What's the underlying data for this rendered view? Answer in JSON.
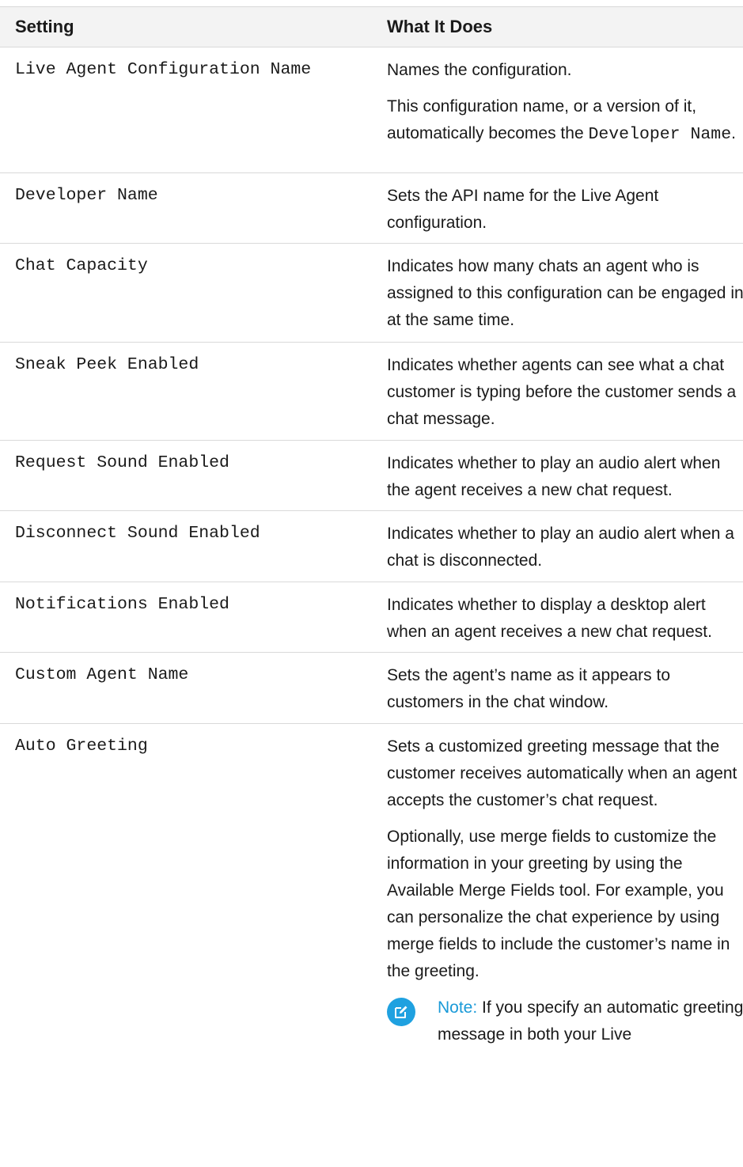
{
  "header": {
    "setting": "Setting",
    "what_it_does": "What It Does"
  },
  "rows": [
    {
      "setting": "Live Agent Configuration Name",
      "p1": "Names the configuration.",
      "p2_pre": "This configuration name, or a version of it, automatically becomes the ",
      "p2_code": "Developer Name",
      "p2_post": "."
    },
    {
      "setting": "Developer Name",
      "desc": "Sets the API name for the Live Agent configuration."
    },
    {
      "setting": "Chat Capacity",
      "desc": "Indicates how many chats an agent who is assigned to this configuration can be engaged in at the same time."
    },
    {
      "setting": "Sneak Peek Enabled",
      "desc": "Indicates whether agents can see what a chat customer is typing before the customer sends a chat message."
    },
    {
      "setting": "Request Sound Enabled",
      "desc": "Indicates whether to play an audio alert when the agent receives a new chat request."
    },
    {
      "setting": "Disconnect Sound Enabled",
      "desc": "Indicates whether to play an audio alert when a chat is disconnected."
    },
    {
      "setting": "Notifications Enabled",
      "desc": "Indicates whether to display a desktop alert when an agent receives a new chat request."
    },
    {
      "setting": "Custom Agent Name",
      "desc": "Sets the agent’s name as it appears to customers in the chat window."
    },
    {
      "setting": "Auto Greeting",
      "p1": "Sets a customized greeting message that the customer receives automatically when an agent accepts the customer’s chat request.",
      "p2": "Optionally, use merge fields to customize the information in your greeting by using the Available Merge Fields tool. For example, you can personalize the chat experience by using merge fields to include the customer’s name in the greeting.",
      "note_label": "Note:",
      "note_text": "If you specify an automatic greeting message in both your Live"
    }
  ],
  "icons": {
    "note": "edit-note-icon"
  },
  "colors": {
    "header_bg": "#f3f3f3",
    "border": "#d9d9d9",
    "note_accent": "#1fa1e0"
  }
}
